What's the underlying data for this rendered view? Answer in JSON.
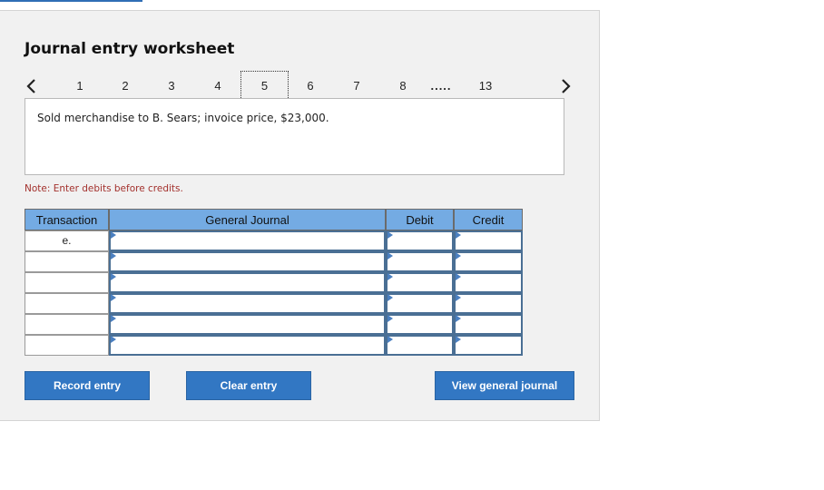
{
  "page": {
    "title": "Journal entry worksheet",
    "pager": {
      "prev_icon": "chevron-left-icon",
      "next_icon": "chevron-right-icon",
      "pages": [
        "1",
        "2",
        "3",
        "4",
        "5",
        "6",
        "7",
        "8"
      ],
      "active": "5",
      "ellipsis": ".....",
      "last": "13"
    },
    "description": "Sold merchandise to B. Sears; invoice price, $23,000.",
    "note": "Note: Enter debits before credits."
  },
  "table": {
    "headers": {
      "transaction": "Transaction",
      "general_journal": "General Journal",
      "debit": "Debit",
      "credit": "Credit"
    },
    "rows": [
      {
        "transaction": "e."
      },
      {
        "transaction": ""
      },
      {
        "transaction": ""
      },
      {
        "transaction": ""
      },
      {
        "transaction": ""
      },
      {
        "transaction": ""
      }
    ]
  },
  "buttons": {
    "record": "Record entry",
    "clear": "Clear entry",
    "view": "View general journal"
  },
  "colors": {
    "header_bg": "#74abe3",
    "button_bg": "#3277c3",
    "note_text": "#a3312d",
    "input_border": "#4a6f94"
  }
}
